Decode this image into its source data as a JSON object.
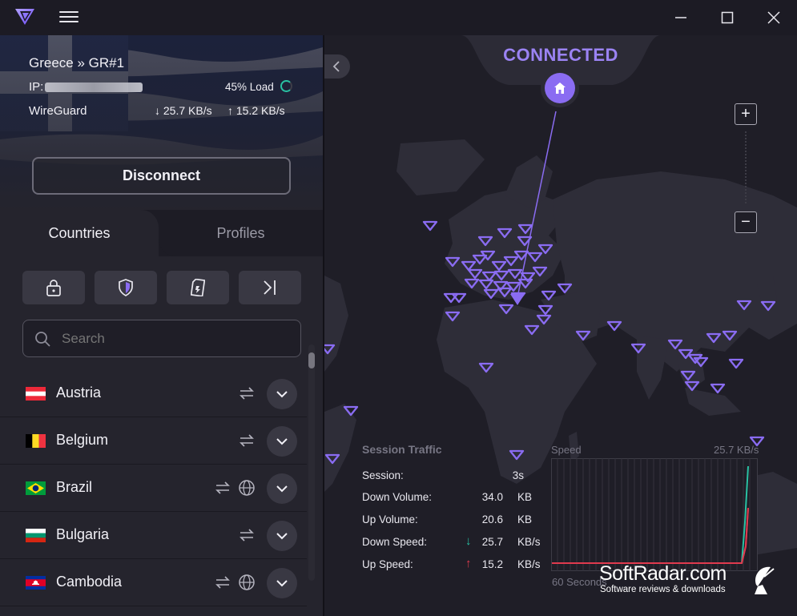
{
  "titlebar": {
    "icons": {
      "logo": "protonvpn-logo",
      "menu": "hamburger-icon",
      "minimize": "minimize-icon",
      "maximize": "maximize-icon",
      "close": "close-icon"
    }
  },
  "connection": {
    "server": "Greece » GR#1",
    "ip_label": "IP:",
    "load": "45% Load",
    "load_percent": 45,
    "protocol": "WireGuard",
    "download_speed": "25.7 KB/s",
    "upload_speed": "15.2 KB/s",
    "disconnect_label": "Disconnect"
  },
  "tabs": [
    {
      "label": "Countries",
      "active": true
    },
    {
      "label": "Profiles",
      "active": false
    }
  ],
  "filters": [
    {
      "icon": "lock-icon"
    },
    {
      "icon": "shield-icon"
    },
    {
      "icon": "sd-card-icon"
    },
    {
      "icon": "arrow-bar-icon"
    }
  ],
  "search": {
    "placeholder": "Search"
  },
  "countries": [
    {
      "name": "Austria",
      "flag": "austria-flag",
      "features": [
        "p2p"
      ]
    },
    {
      "name": "Belgium",
      "flag": "belgium-flag",
      "features": [
        "p2p"
      ]
    },
    {
      "name": "Brazil",
      "flag": "brazil-flag",
      "features": [
        "p2p",
        "tor"
      ]
    },
    {
      "name": "Bulgaria",
      "flag": "bulgaria-flag",
      "features": [
        "p2p"
      ]
    },
    {
      "name": "Cambodia",
      "flag": "cambodia-flag",
      "features": [
        "p2p",
        "tor"
      ]
    }
  ],
  "map": {
    "status": "CONNECTED",
    "accent_color": "#8a6cf2",
    "zoom_in": "+",
    "zoom_out": "−"
  },
  "session_traffic": {
    "title": "Session Traffic",
    "rows": [
      {
        "label": "Session:",
        "value": "3s",
        "unit": ""
      },
      {
        "label": "Down Volume:",
        "value": "34.0",
        "unit": "KB"
      },
      {
        "label": "Up Volume:",
        "value": "20.6",
        "unit": "KB"
      },
      {
        "label": "Down Speed:",
        "value": "25.7",
        "unit": "KB/s"
      },
      {
        "label": "Up Speed:",
        "value": "15.2",
        "unit": "KB/s"
      }
    ]
  },
  "speed_graph": {
    "label": "Speed",
    "max_label": "25.7  KB/s",
    "seconds_label": "60 Seconds"
  },
  "watermark": {
    "title": "SoftRadar.com",
    "subtitle": "Software reviews & downloads"
  }
}
